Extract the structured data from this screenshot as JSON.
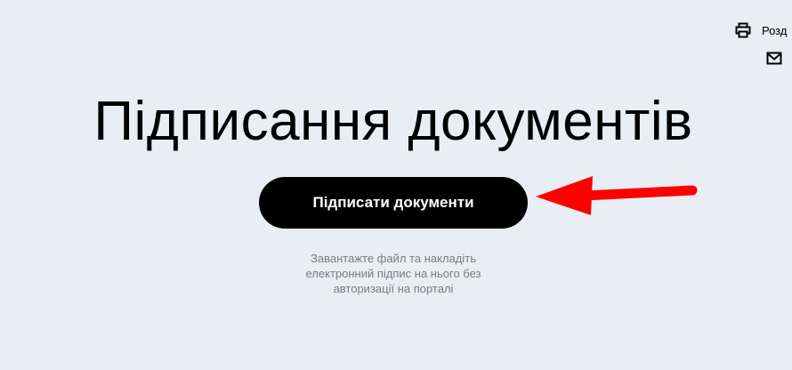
{
  "toolbar": {
    "print_icon": "printer-icon",
    "print_label": "Розд",
    "mail_icon": "envelope-icon"
  },
  "main": {
    "title": "Підписання документів",
    "sign_button_label": "Підписати документи",
    "description": "Завантажте файл та накладіть електронний підпис на нього без авторизації на порталі"
  },
  "annotation": {
    "arrow_icon": "red-arrow-icon",
    "arrow_color": "#ff0000"
  },
  "colors": {
    "background": "#e8eef3",
    "button": "#000000",
    "button_text": "#ffffff",
    "description_text": "#777c82"
  }
}
